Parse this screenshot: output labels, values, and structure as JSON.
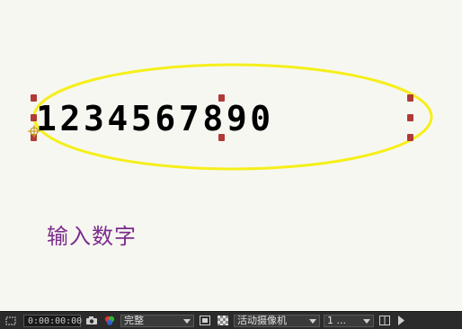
{
  "composition": {
    "text_layer": "1234567890",
    "caption": "输入数字"
  },
  "toolbar": {
    "timecode": "0:00:00:00",
    "resolution": "完整",
    "camera": "活动摄像机",
    "views": "1 ..."
  },
  "colors": {
    "ellipse": "#f5ef1a",
    "handle": "#b03a36",
    "caption": "#7b2c8c",
    "canvas_bg": "#f7f7f1",
    "toolbar_bg": "#2b2b2b"
  }
}
